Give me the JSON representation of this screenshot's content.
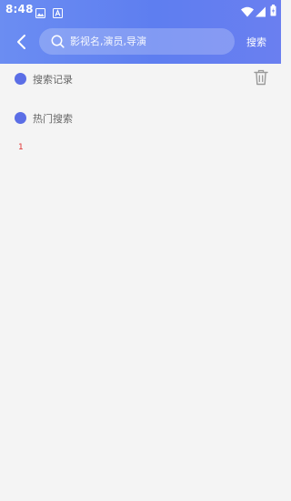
{
  "status_bar": {
    "time": "8:48",
    "left_icons": [
      "image-icon",
      "a-icon"
    ],
    "right_icons": [
      "wifi-icon",
      "signal-icon",
      "battery-icon"
    ]
  },
  "search": {
    "placeholder": "影视名,演员,导演",
    "value": "",
    "button_label": "搜索"
  },
  "history": {
    "title": "搜索记录",
    "clear_icon": "trash-icon"
  },
  "hot": {
    "title": "热门搜索",
    "items": [
      "1"
    ]
  },
  "colors": {
    "header_start": "#6b8df2",
    "header_end": "#6a7ff0",
    "accent_dot": "#5b6ee6",
    "background": "#f4f4f4",
    "hot_rank": "#e03030"
  }
}
